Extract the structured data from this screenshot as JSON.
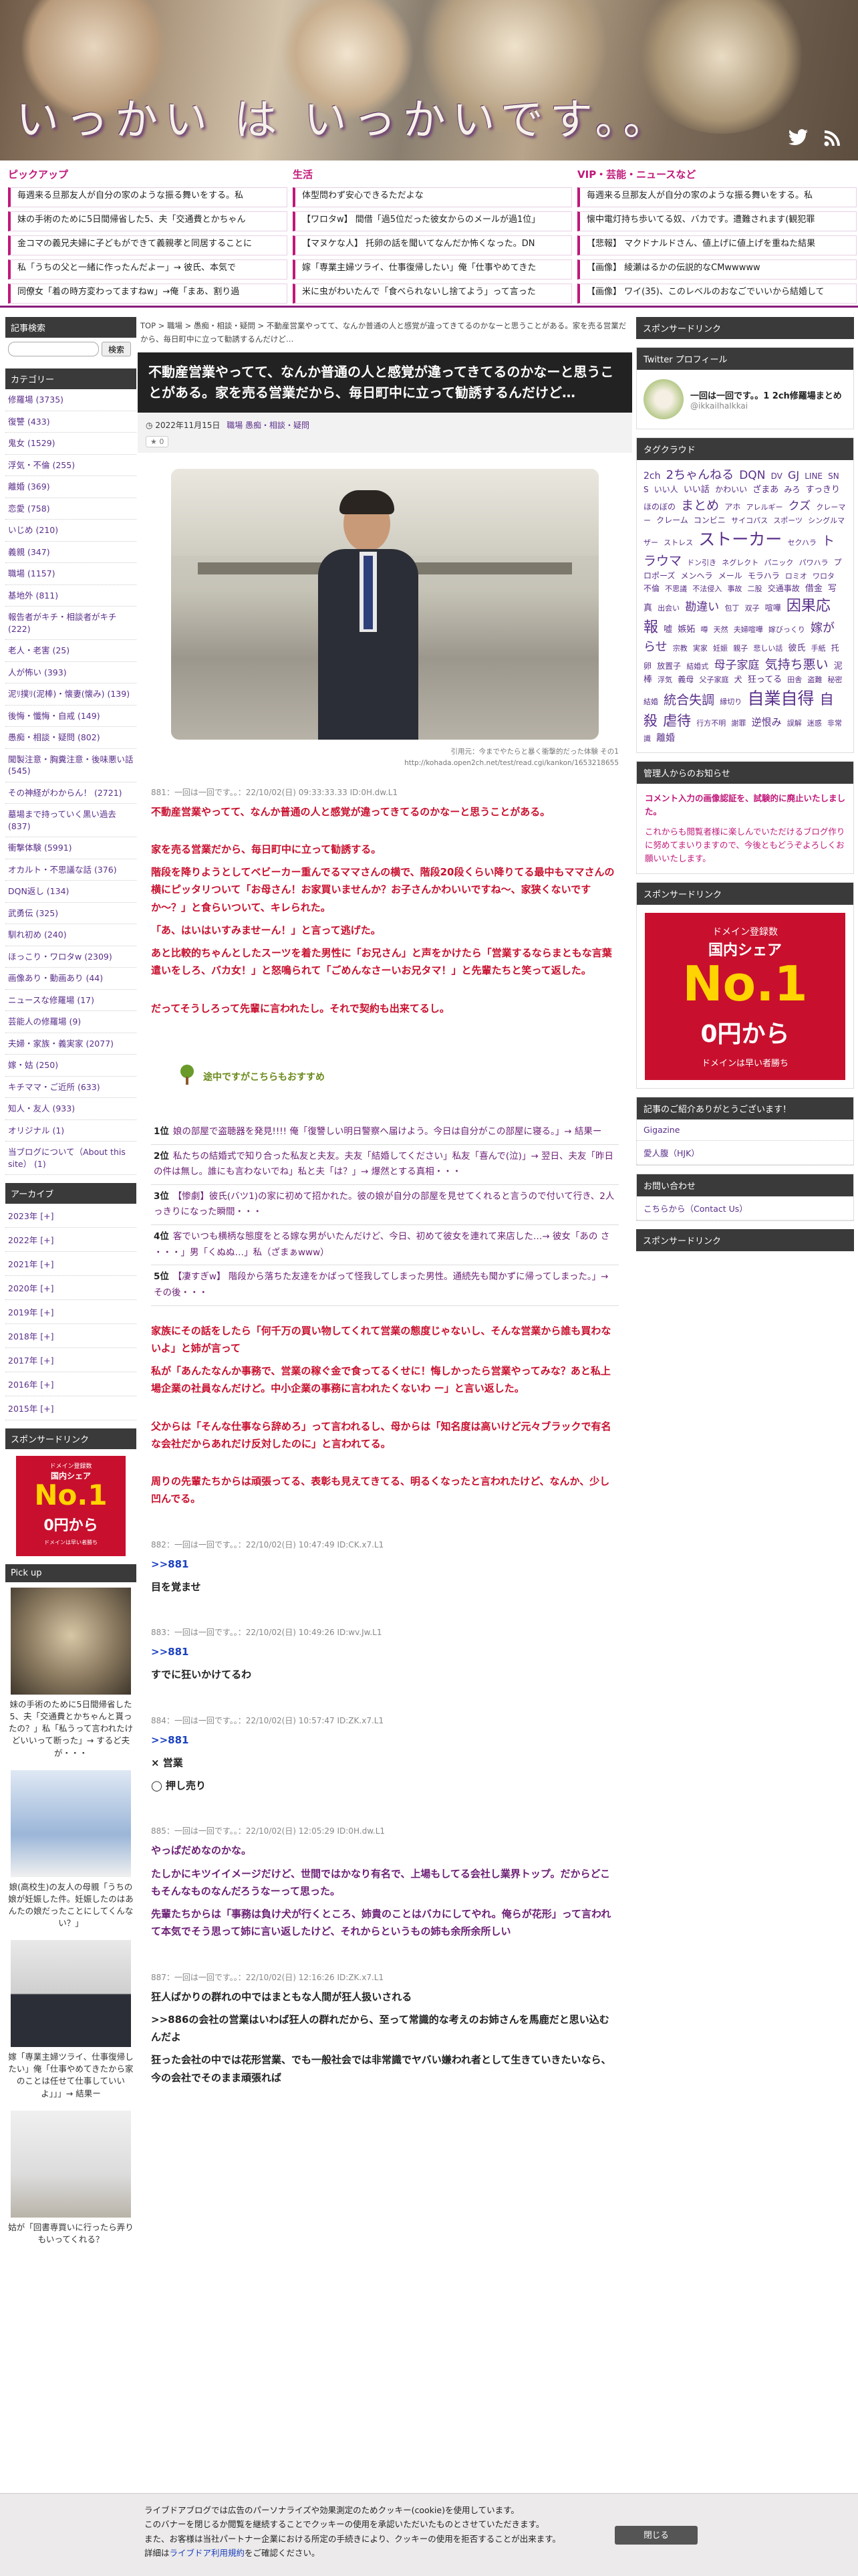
{
  "header": {
    "site_title": "いっかい は いっかいです。。",
    "icons": [
      "twitter-icon",
      "rss-icon"
    ]
  },
  "pickup": {
    "categories": [
      "ピックアップ",
      "生活",
      "VIP・芸能・ニュースなど"
    ],
    "rows": [
      [
        "毎週来る旦那友人が自分の家のような振る舞いをする。私",
        "体型問わず安心できるただよな",
        "毎週来る旦那友人が自分の家のような振る舞いをする。私"
      ],
      [
        "妹の手術のために5日間帰省した5、夫「交通費とかちゃん",
        "【ワロタw】 間借「過5位だった彼女からのメールが過1位」",
        "懐中電灯持ち歩いてる奴、バカです。遭難されます(観犯罪"
      ],
      [
        "金コマの義兄夫婦に子どもができて義親孝と同居することに",
        "【マヌケな人】 托卵の話を聞いてなんだか怖くなった。DN",
        "【悲報】 マクドナルドさん、値上げに値上げを重ねた結果"
      ],
      [
        "私「うちの父と一緒に作ったんだよー」→ 彼氏、本気で",
        "嫁「専業主婦ツライ、仕事復帰したい」俺「仕事やめてきた",
        "【画像】 綾瀬はるかの伝説的なCMwwwww"
      ],
      [
        "同僚女「着の時方変わってますねw」→俺「まあ、割り過",
        "米に虫がわいたんで「食べられないし捨てよう」って言った",
        "【画像】 ワイ(35)、このレベルのおなごでいいから結婚して"
      ]
    ]
  },
  "left": {
    "search_header": "記事検索",
    "search_button": "検索",
    "category_header": "カテゴリー",
    "categories": [
      "修羅場 (3735)",
      "復讐 (433)",
      "鬼女 (1529)",
      "浮気・不倫 (255)",
      "離婚 (369)",
      "恋愛 (758)",
      "いじめ (210)",
      "義親 (347)",
      "職場 (1157)",
      "基地外 (811)",
      "報告者がキチ・相談者がキチ (222)",
      "老人・老害 (25)",
      "人が怖い (393)",
      "泥ﾘ撲ﾘ(泥棒)・懐妻(懐み) (139)",
      "後悔・懺悔・自戒 (149)",
      "愚痴・相談・疑問 (802)",
      "聞製注意・胸糞注意・後味悪い話 (545)",
      "その神経がわからん！ (2721)",
      "墓場まで持っていく黒い過去 (837)",
      "衝撃体験 (5991)",
      "オカルト・不思議な話 (376)",
      "DQN返し (134)",
      "武勇伝 (325)",
      "馴れ初め (240)",
      "ほっこり・ワロタw (2309)",
      "画像あり・動画あり (44)",
      "ニュースな修羅場 (17)",
      "芸能人の修羅場 (9)",
      "夫婦・家族・義実家 (2077)",
      "嫁・姑 (250)",
      "キチママ・ご近所 (633)",
      "知人・友人 (933)",
      "オリジナル (1)",
      "当ブログについて（About this site） (1)"
    ],
    "archive_header": "アーカイブ",
    "archives": [
      "2023年 [+]",
      "2022年 [+]",
      "2021年 [+]",
      "2020年 [+]",
      "2019年 [+]",
      "2018年 [+]",
      "2017年 [+]",
      "2016年 [+]",
      "2015年 [+]"
    ],
    "sponsor_header": "スポンサードリンク",
    "ad": {
      "line1": "ドメイン登録数",
      "line2": "国内シェア",
      "line3": "No.1",
      "line4": "0円から",
      "line5": "ドメインは早い者勝ち"
    },
    "pickup_header": "Pick up",
    "pickups": [
      "妹の手術のために5日間帰省した5、夫「交通費とかちゃんと貰ったの？」私「私うって言われたけどいいって断った」→ するど夫が・・・",
      "娘(高校生)の友人の母親「うちの娘が妊娠した件。妊娠したのはあんたの娘だったことにしてくんない？」",
      "嫁「専業主婦ツライ、仕事復帰したい」俺「仕事やめてきたから家のことは任せて仕事していいよ」」」→ 結果ー",
      "姑が「回書専買いに行ったら弄りもいってくれる？"
    ]
  },
  "main": {
    "breadcrumb": "TOP > 職場 > 愚痴・相談・疑問 > 不動産営業やってて、なんか普通の人と感覚が違ってきてるのかなーと思うことがある。家を売る営業だから、毎日町中に立って勧誘するんだけど…",
    "title": "不動産営業やってて、なんか普通の人と感覚が違ってきてるのかなーと思うことがある。家を売る営業だから、毎日町中に立って勧誘するんだけど…",
    "date": "2022年11月15日",
    "tags": "職場 愚痴・相談・疑問",
    "star": "0",
    "photo_caption_1": "引用元：今までやたらと暴く衝撃的だった体験 その1",
    "photo_caption_2": "http://kohada.open2ch.net/test/read.cgi/kankon/1653218655",
    "posts": [
      {
        "header": "881：一回は一回です。。：22/10/02(日) 09:33:33.33 ID:0H.dw.L1",
        "lines": [
          {
            "c": "red",
            "t": "不動産営業やってて、なんか普通の人と感覚が違ってきてるのかなーと思うことがある。"
          },
          {
            "c": "blank",
            "t": ""
          },
          {
            "c": "red",
            "t": "家を売る営業だから、毎日町中に立って勧誘する。"
          },
          {
            "c": "red",
            "t": "階段を降りようとしてベビーカー重んでるママさんの横で、階段20段くらい降りてる最中もママさんの横にピッタリついて「お母さん！お家買いませんか？お子さんかわいいですね〜、家狭くないですか〜？」と食らいついて、キレられた。"
          },
          {
            "c": "red",
            "t": "「あ、はいはいすみませーん！」と言って逃げた。"
          },
          {
            "c": "red",
            "t": "あと比較的ちゃんとしたスーツを着た男性に「お兄さん」と声をかけたら「営業するならまともな言葉遣いをしろ、バカ女！」と怒鳴られて「ごめんなさーいお兄タマ！」と先輩たちと笑って返した。"
          },
          {
            "c": "blank",
            "t": ""
          },
          {
            "c": "red",
            "t": "だってそうしろって先輩に言われたし。それで契約も出来てるし。"
          }
        ]
      }
    ],
    "reco_title": "途中ですがこちらもおすすめ",
    "reco": [
      {
        "n": "1位",
        "t": "娘の部屋で盗聴器を発見!!!! 俺「復讐しい明日警察へ届けよう。今日は自分がこの部屋に寝る。」→ 結果ー"
      },
      {
        "n": "2位",
        "t": "私たちの結婚式で知り合った私友と夫友。夫友「結婚してください」私友「喜んで(泣)」→ 翌日、夫友「昨日の件は無し。誰にも言わないでね」私と夫「は？」→ 爆然とする真相・・・"
      },
      {
        "n": "3位",
        "t": "【惨劇】彼氏(バツ1)の家に初めて招かれた。彼の娘が自分の部屋を見せてくれると言うので付いて行き、2人っきりになった瞬間・・・"
      },
      {
        "n": "4位",
        "t": "客でいつも横柄な態度をとる嫁な男がいたんだけど、今日、初めて彼女を連れて来店した…→ 彼女「あの さ ・・・」男「くぬぬ…」私（ざまぁwww）"
      },
      {
        "n": "5位",
        "t": "【凄すぎw】 階段から落ちた友達をかばって怪我してしまった男性。通続先も聞かずに帰ってしまった。」→ その後・・・"
      }
    ],
    "after": [
      {
        "c": "red",
        "t": "家族にその話をしたら「何千万の買い物してくれて営業の態度じゃないし、そんな営業から誰も買わないよ」と姉が言って"
      },
      {
        "c": "red",
        "t": "私が「あんたなんか事務で、営業の稼ぐ金で食ってるくせに！悔しかったら営業やってみな？あと私上場企業の社員なんだけど。中小企業の事務に言われたくないわ ー」と言い返した。"
      },
      {
        "c": "blank",
        "t": ""
      },
      {
        "c": "red",
        "t": "父からは「そんな仕事なら辞めろ」って言われるし、母からは「知名度は高いけど元々ブラックで有名な会社だからあれだけ反対したのに」と言われてる。"
      },
      {
        "c": "blank",
        "t": ""
      },
      {
        "c": "red",
        "t": "周りの先輩たちからは頑張ってる、表彰も見えてきてる、明るくなったと言われたけど、なんか、少し凹んでる。"
      }
    ],
    "replies": [
      {
        "header": "882：一回は一回です。。：22/10/02(日) 10:47:49 ID:CK.x7.L1",
        "anchor": ">>881",
        "lines": [
          {
            "c": "dark",
            "t": "目を覚ませ"
          }
        ]
      },
      {
        "header": "883：一回は一回です。。：22/10/02(日) 10:49:26 ID:wv.Jw.L1",
        "anchor": ">>881",
        "lines": [
          {
            "c": "dark",
            "t": "すでに狂いかけてるわ"
          }
        ]
      },
      {
        "header": "884：一回は一回です。。：22/10/02(日) 10:57:47 ID:ZK.x7.L1",
        "anchor": ">>881",
        "lines": [
          {
            "c": "dark",
            "t": "× 営業"
          },
          {
            "c": "dark",
            "t": "◯ 押し売り"
          }
        ]
      },
      {
        "header": "885：一回は一回です。。：22/10/02(日) 12:05:29 ID:0H.dw.L1",
        "anchor": "",
        "lines": [
          {
            "c": "purple",
            "t": "やっぱだめなのかな。"
          },
          {
            "c": "purple",
            "t": "たしかにキツイイメージだけど、世間ではかなり有名で、上場もしてる会社し業界トップ。だからどこもそんなものなんだろうなーって思った。"
          },
          {
            "c": "purple",
            "t": "先輩たちからは「事務は負け犬が行くところ、姉貴のことはバカにしてやれ。俺らが花形」って言われて本気でそう思って姉に言い返したけど、それからというもの姉も余所余所しい"
          }
        ]
      },
      {
        "header": "887：一回は一回です。。：22/10/02(日) 12:16:26 ID:ZK.x7.L1",
        "anchor": "",
        "lines": [
          {
            "c": "dark",
            "t": "狂人ばかりの群れの中ではまともな人間が狂人扱いされる"
          },
          {
            "c": "dark",
            "t": ">>886の会社の営業はいわば狂人の群れだから、至って常識的な考えのお姉さんを馬鹿だと思い込むんだよ"
          },
          {
            "c": "dark",
            "t": "狂った会社の中では花形営業、でも一般社会では非常識でヤバい嫌われ者として生きていきたいなら、今の会社でそのまま頑張れば"
          }
        ]
      }
    ]
  },
  "right": {
    "sponsor_header": "スポンサードリンク",
    "twitter_header": "Twitter プロフィール",
    "twitter_name": "一回は一回です。。1 2ch修羅場まとめ",
    "twitter_id": "@ikkaiIhaIkkai",
    "tag_header": "タグクラウド",
    "tags": [
      {
        "t": "2ch",
        "s": 14
      },
      {
        "t": "2ちゃんねる",
        "s": 18
      },
      {
        "t": "DQN",
        "s": 17
      },
      {
        "t": "DV",
        "s": 12
      },
      {
        "t": "GJ",
        "s": 16
      },
      {
        "t": "LINE",
        "s": 12
      },
      {
        "t": "SNS",
        "s": 12
      },
      {
        "t": "いい人",
        "s": 12
      },
      {
        "t": "いい話",
        "s": 13
      },
      {
        "t": "かわいい",
        "s": 12
      },
      {
        "t": "ざまあ",
        "s": 13
      },
      {
        "t": "みろ",
        "s": 12
      },
      {
        "t": "すっきり",
        "s": 13
      },
      {
        "t": "ほのぼの",
        "s": 12
      },
      {
        "t": "まとめ",
        "s": 19
      },
      {
        "t": "アホ",
        "s": 12
      },
      {
        "t": "アレルギー",
        "s": 11
      },
      {
        "t": "クズ",
        "s": 17
      },
      {
        "t": "クレーマー",
        "s": 11
      },
      {
        "t": "クレーム",
        "s": 12
      },
      {
        "t": "コンビニ",
        "s": 12
      },
      {
        "t": "サイコパス",
        "s": 11
      },
      {
        "t": "スポーツ",
        "s": 11
      },
      {
        "t": "シングルマザー",
        "s": 11
      },
      {
        "t": "ストレス",
        "s": 11
      },
      {
        "t": "ストーカー",
        "s": 25
      },
      {
        "t": "セクハラ",
        "s": 11
      },
      {
        "t": "トラウマ",
        "s": 19
      },
      {
        "t": "ドン引き",
        "s": 11
      },
      {
        "t": "ネグレクト",
        "s": 11
      },
      {
        "t": "パニック",
        "s": 11
      },
      {
        "t": "パワハラ",
        "s": 11
      },
      {
        "t": "プロポーズ",
        "s": 12
      },
      {
        "t": "メンヘラ",
        "s": 12
      },
      {
        "t": "メール",
        "s": 12
      },
      {
        "t": "モラハラ",
        "s": 12
      },
      {
        "t": "ロミオ",
        "s": 11
      },
      {
        "t": "ワロタ",
        "s": 11
      },
      {
        "t": "不倫",
        "s": 12
      },
      {
        "t": "不思議",
        "s": 11
      },
      {
        "t": "不法侵入",
        "s": 11
      },
      {
        "t": "事故",
        "s": 11
      },
      {
        "t": "二股",
        "s": 11
      },
      {
        "t": "交通事故",
        "s": 12
      },
      {
        "t": "借金",
        "s": 13
      },
      {
        "t": "写真",
        "s": 13
      },
      {
        "t": "出会い",
        "s": 11
      },
      {
        "t": "勘違い",
        "s": 17
      },
      {
        "t": "包丁",
        "s": 11
      },
      {
        "t": "双子",
        "s": 11
      },
      {
        "t": "喧嘩",
        "s": 12
      },
      {
        "t": "因果応報",
        "s": 22
      },
      {
        "t": "嘘",
        "s": 13
      },
      {
        "t": "嫉妬",
        "s": 13
      },
      {
        "t": "噂",
        "s": 11
      },
      {
        "t": "天然",
        "s": 11
      },
      {
        "t": "夫婦喧嘩",
        "s": 11
      },
      {
        "t": "嫁びっくり",
        "s": 11
      },
      {
        "t": "嫁がらせ",
        "s": 18
      },
      {
        "t": "宗教",
        "s": 11
      },
      {
        "t": "実家",
        "s": 11
      },
      {
        "t": "妊娠",
        "s": 11
      },
      {
        "t": "親子",
        "s": 11
      },
      {
        "t": "悲しい話",
        "s": 11
      },
      {
        "t": "彼氏",
        "s": 13
      },
      {
        "t": "手紙",
        "s": 11
      },
      {
        "t": "托卵",
        "s": 12
      },
      {
        "t": "放置子",
        "s": 12
      },
      {
        "t": "結婚式",
        "s": 11
      },
      {
        "t": "母子家庭",
        "s": 17
      },
      {
        "t": "気持ち悪い",
        "s": 19
      },
      {
        "t": "泥棒",
        "s": 13
      },
      {
        "t": "浮気",
        "s": 11
      },
      {
        "t": "義母",
        "s": 12
      },
      {
        "t": "父子家庭",
        "s": 11
      },
      {
        "t": "犬",
        "s": 12
      },
      {
        "t": "狂ってる",
        "s": 13
      },
      {
        "t": "田舎",
        "s": 11
      },
      {
        "t": "盗難",
        "s": 11
      },
      {
        "t": "秘密",
        "s": 11
      },
      {
        "t": "結婚",
        "s": 11
      },
      {
        "t": "統合失調",
        "s": 19
      },
      {
        "t": "縁切り",
        "s": 11
      },
      {
        "t": "自業自得",
        "s": 25
      },
      {
        "t": "自殺",
        "s": 21
      },
      {
        "t": "虐待",
        "s": 21
      },
      {
        "t": "行方不明",
        "s": 11
      },
      {
        "t": "謝罪",
        "s": 11
      },
      {
        "t": "逆恨み",
        "s": 15
      },
      {
        "t": "誤解",
        "s": 11
      },
      {
        "t": "迷惑",
        "s": 11
      },
      {
        "t": "非常識",
        "s": 11
      },
      {
        "t": "離婚",
        "s": 14
      }
    ],
    "admin_header": "管理人からのお知らせ",
    "admin_notice_1": "コメント入力の画像認証を、試験的に廃止いたしました。",
    "admin_notice_2": "これからも閲覧者様に楽しんでいただけるブログ作りに努めてまいりますので、今後ともどうぞよろしくお願いいたします。",
    "sponsor_header_2": "スポンサードリンク",
    "intro_header": "記事のご紹介ありがとうございます！",
    "intro_links": [
      "Gigazine",
      "愛人腹（HJK）"
    ],
    "contact_header": "お問い合わせ",
    "contact_link": "こちらから（Contact Us）",
    "sponsor_header_3": "スポンサードリンク"
  },
  "cookie": {
    "text_1": "ライブドアブログでは広告のパーソナライズや効果測定のためクッキー(cookie)を使用しています。",
    "text_2": "このバナーを閉じるか閲覧を継続することでクッキーの使用を承認いただいたものとさせていただきます。",
    "text_3": "また、お客様は当社パートナー企業における所定の手続きにより、クッキーの使用を拒否することが出来ます。",
    "text_4_pre": "詳細は",
    "text_4_link": "ライブドア利用規約",
    "text_4_post": "をご確認ください。",
    "close": "閉じる"
  }
}
